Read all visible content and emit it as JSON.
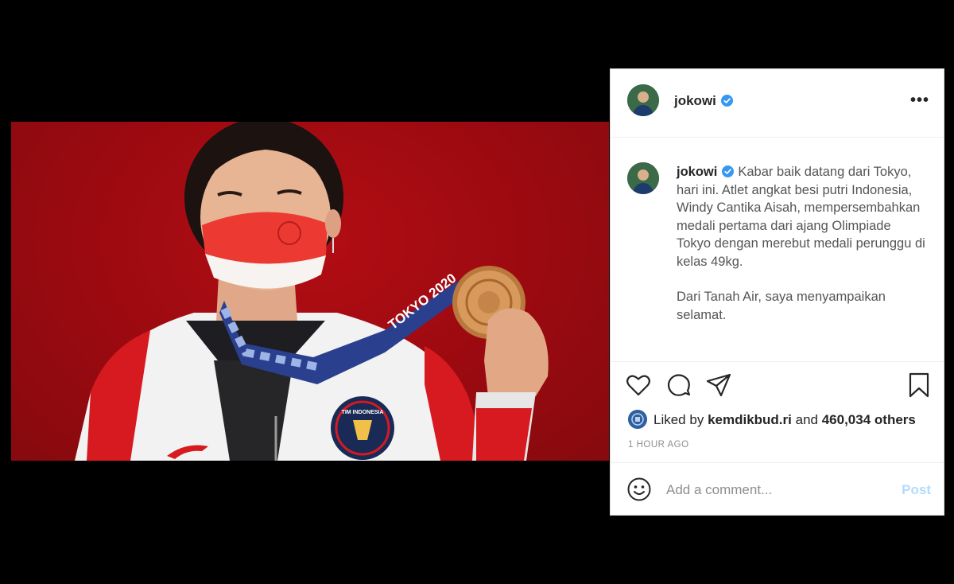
{
  "post": {
    "username": "jokowi",
    "verified": true,
    "more_icon": "more-options-icon",
    "caption": {
      "username": "jokowi",
      "paragraph1": "Kabar baik datang dari Tokyo, hari ini. Atlet angkat besi putri Indonesia, Windy Cantika Aisah, mempersembahkan medali pertama dari ajang Olimpiade Tokyo dengan merebut medali perunggu di kelas 49kg.",
      "paragraph2": "Dari Tanah Air, saya menyampaikan selamat."
    },
    "photo_texts": {
      "ribbon": "TOKYO 2020",
      "emblem": "TIM INDONESIA"
    },
    "likes": {
      "prefix": "Liked by",
      "user": "kemdikbud.ri",
      "middle": "and",
      "count": "460,034 others"
    },
    "timestamp": "1 HOUR AGO",
    "comment": {
      "placeholder": "Add a comment...",
      "post_label": "Post"
    },
    "icons": [
      "heart-icon",
      "comment-icon",
      "share-icon",
      "bookmark-icon",
      "emoji-icon",
      "verified-badge-icon"
    ],
    "colors": {
      "verified": "#3897f0",
      "post_disabled": "#b3dbff",
      "photo_background": "#9a0a10"
    }
  }
}
